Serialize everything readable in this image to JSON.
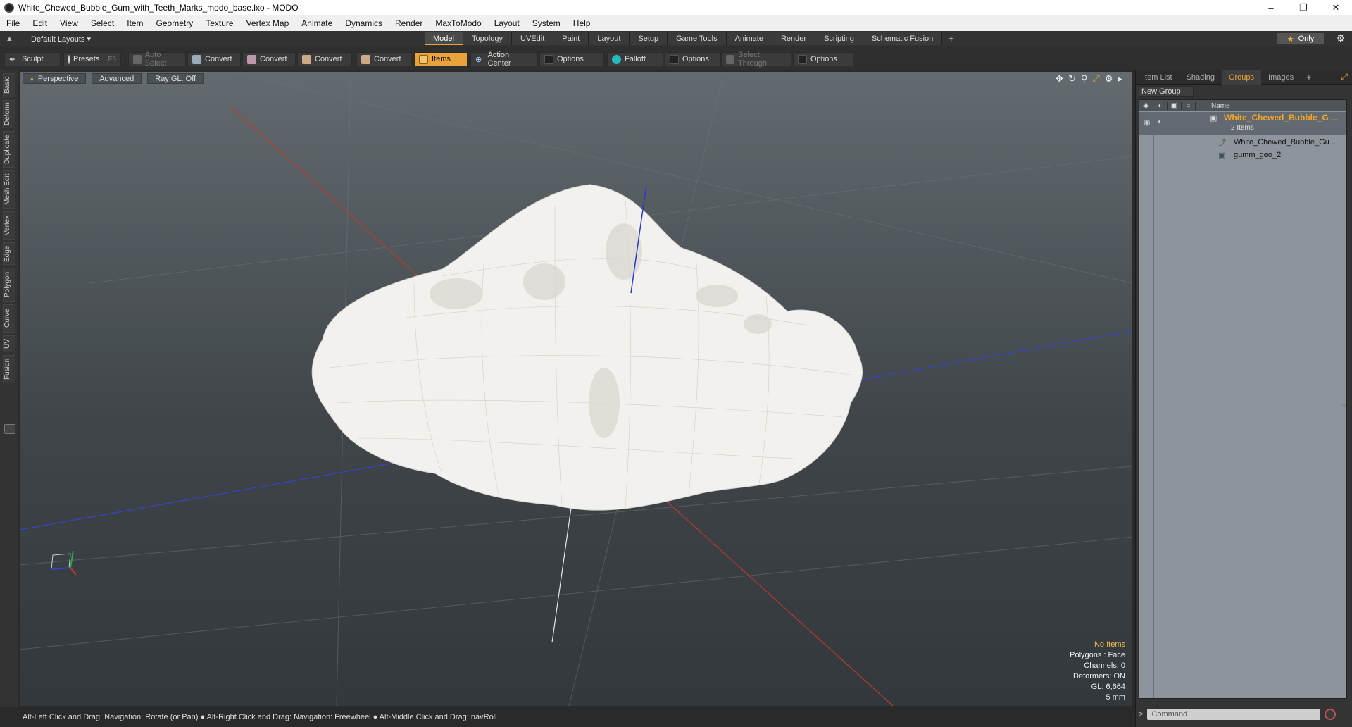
{
  "window": {
    "title": "White_Chewed_Bubble_Gum_with_Teeth_Marks_modo_base.lxo - MODO",
    "minimize": "–",
    "maximize": "❐",
    "close": "✕"
  },
  "menu": [
    "File",
    "Edit",
    "View",
    "Select",
    "Item",
    "Geometry",
    "Texture",
    "Vertex Map",
    "Animate",
    "Dynamics",
    "Render",
    "MaxToModo",
    "Layout",
    "System",
    "Help"
  ],
  "layout_selector": "Default Layouts ▾",
  "tabs": [
    "Model",
    "Topology",
    "UVEdit",
    "Paint",
    "Layout",
    "Setup",
    "Game Tools",
    "Animate",
    "Render",
    "Scripting",
    "Schematic Fusion"
  ],
  "active_tab": "Model",
  "only_label": "Only",
  "toolbar": {
    "sculpt": "Sculpt",
    "presets": "Presets",
    "presets_key": "F6",
    "auto_select": "Auto Select",
    "convert1": "Convert",
    "convert2": "Convert",
    "convert3": "Convert",
    "convert4": "Convert",
    "items": "Items",
    "action_center": "Action Center",
    "options1": "Options",
    "falloff": "Falloff",
    "options2": "Options",
    "select_through": "Select Through",
    "options3": "Options"
  },
  "left_tabs": [
    "Basic",
    "Deform",
    "Duplicate",
    "Mesh Edit",
    "Vertex",
    "Edge",
    "Polygon",
    "Curve",
    "UV",
    "Fusion"
  ],
  "viewport": {
    "perspective": "Perspective",
    "advanced": "Advanced",
    "raygl": "Ray GL: Off",
    "stats": {
      "no_items": "No Items",
      "polygons": "Polygons : Face",
      "channels": "Channels: 0",
      "deformers": "Deformers: ON",
      "gl": "GL: 6,664",
      "unit": "5 mm"
    }
  },
  "status": "Alt-Left Click and Drag: Navigation: Rotate (or Pan) ●  Alt-Right Click and Drag: Navigation: Freewheel ●  Alt-Middle Click and Drag: navRoll",
  "right_panel": {
    "tabs": [
      "Item List",
      "Shading",
      "Groups",
      "Images"
    ],
    "active_tab": "Groups",
    "new_group": "New Group",
    "name_header": "Name",
    "group_name": "White_Chewed_Bubble_G ...",
    "group_count": "2 Items",
    "child1": "White_Chewed_Bubble_Gu ...",
    "child2": "gumm_geo_2",
    "command_placeholder": "Command"
  },
  "colors": {
    "accent": "#e8a33c",
    "group_name": "#f5a623"
  }
}
